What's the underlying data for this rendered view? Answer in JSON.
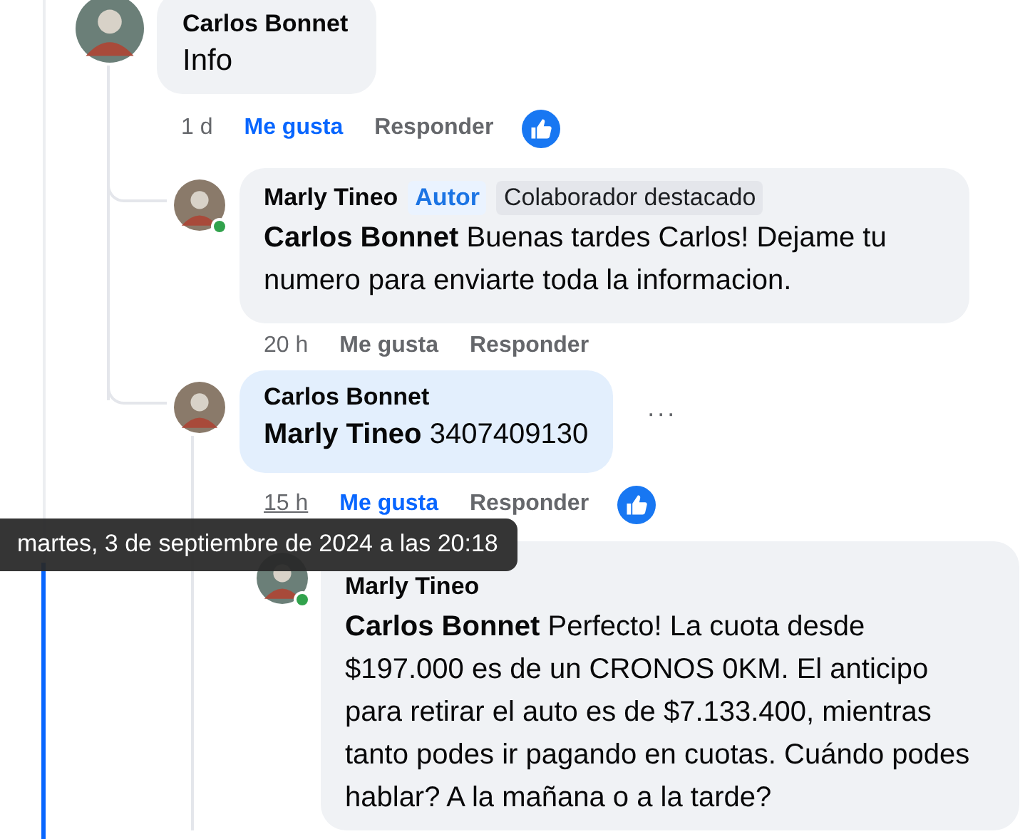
{
  "comments": [
    {
      "author": "Carlos Bonnet",
      "text": "Info",
      "time": "1 d",
      "like_label": "Me gusta",
      "liked": true,
      "reply_label": "Responder",
      "reacted": true,
      "online": false,
      "highlighted": false,
      "children": [
        {
          "author": "Marly Tineo",
          "badges": [
            {
              "label": "Autor",
              "kind": "author"
            },
            {
              "label": "Colaborador destacado",
              "kind": "fan"
            }
          ],
          "mention": "Carlos Bonnet",
          "text": "Buenas tardes Carlos! Dejame tu numero para enviarte toda la informacion.",
          "time": "20 h",
          "like_label": "Me gusta",
          "liked": false,
          "reply_label": "Responder",
          "reacted": false,
          "online": true,
          "highlighted": false
        },
        {
          "author": "Carlos Bonnet",
          "mention": "Marly Tineo",
          "text": "3407409130",
          "time": "15 h",
          "time_underlined": true,
          "like_label": "Me gusta",
          "liked": true,
          "reply_label": "Responder",
          "reacted": true,
          "online": false,
          "highlighted": true,
          "more_menu": "···",
          "tooltip": "martes, 3 de septiembre de 2024 a las 20:18",
          "children": [
            {
              "author": "Marly Tineo",
              "mention": "Carlos Bonnet",
              "text": "Perfecto! La cuota desde $197.000 es de un CRONOS 0KM. El anticipo para retirar el auto es de $7.133.400, mientras tanto podes ir pagando en cuotas. Cuándo podes hablar? A la mañana o a la tarde?",
              "online": true,
              "highlighted": false
            }
          ]
        }
      ]
    }
  ]
}
